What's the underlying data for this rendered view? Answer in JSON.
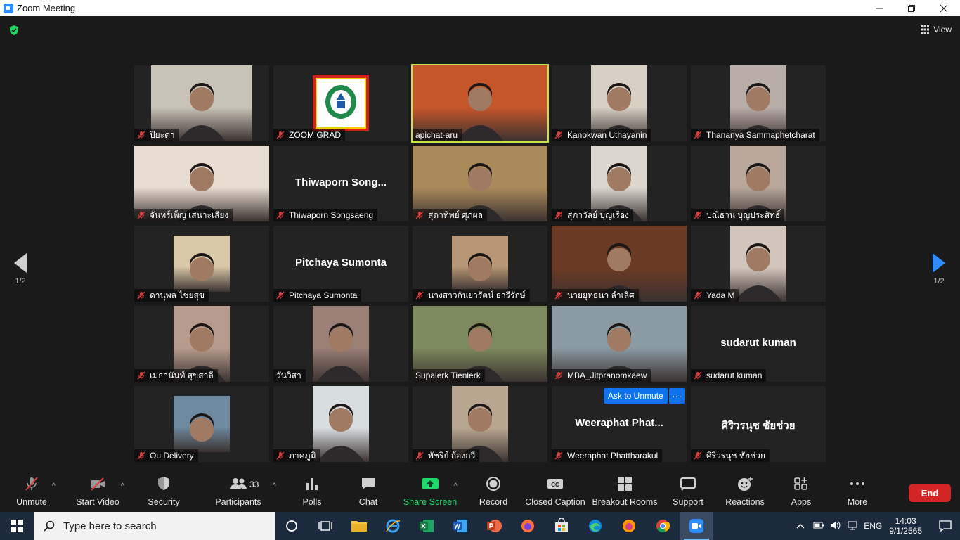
{
  "window": {
    "title": "Zoom Meeting"
  },
  "top": {
    "view_label": "View"
  },
  "pagination": {
    "left": "1/2",
    "right": "1/2"
  },
  "participants": [
    {
      "name": "ปิยะดา",
      "muted": true,
      "kind": "video",
      "bg": "#c9c2b6",
      "vx": 24,
      "vw": 144
    },
    {
      "name": "ZOOM GRAD",
      "muted": true,
      "kind": "logo",
      "bg": "#232323"
    },
    {
      "name": "apichat-aru",
      "muted": false,
      "kind": "video",
      "bg": "#c5562a",
      "vx": 0,
      "vw": 192,
      "active": true
    },
    {
      "name": "Kanokwan Uthayanin",
      "muted": true,
      "kind": "video",
      "bg": "#d8d0c4",
      "vx": 56,
      "vw": 80
    },
    {
      "name": "Thananya Sammaphetcharat",
      "muted": true,
      "kind": "video",
      "bg": "#b9ada8",
      "vx": 56,
      "vw": 80
    },
    {
      "name": "จันทร์เพ็ญ  เสนาะเสียง",
      "muted": true,
      "kind": "video",
      "bg": "#e6dccf",
      "vx": 0,
      "vw": 192
    },
    {
      "name": "Thiwaporn Songsaeng",
      "muted": true,
      "kind": "name",
      "display": "Thiwaporn  Song..."
    },
    {
      "name": "สุดาทิพย์  ศุภผล",
      "muted": true,
      "kind": "video",
      "bg": "#a98a5b",
      "vx": 0,
      "vw": 192
    },
    {
      "name": "สุภาวัลย์ บุญเรือง",
      "muted": true,
      "kind": "video",
      "bg": "#dcd6cf",
      "vx": 56,
      "vw": 80
    },
    {
      "name": "ปณิธาน บุญประสิทธิ์",
      "muted": true,
      "kind": "video",
      "bg": "#b8a79a",
      "vx": 56,
      "vw": 80
    },
    {
      "name": "ดานุพล ไชยสุข",
      "muted": true,
      "kind": "video",
      "bg": "#d8c8a8",
      "vx": 56,
      "vw": 80,
      "short": true
    },
    {
      "name": "Pitchaya Sumonta",
      "muted": true,
      "kind": "name",
      "display": "Pitchaya Sumonta"
    },
    {
      "name": "นางสาวกันยารัตน์ ธารีรักษ์",
      "muted": true,
      "kind": "video",
      "bg": "#b69674",
      "vx": 56,
      "vw": 80,
      "short": true
    },
    {
      "name": "นายยุทธนา  ลำเลิศ",
      "muted": true,
      "kind": "video",
      "bg": "#6b3a24",
      "vx": 0,
      "vw": 192
    },
    {
      "name": "Yada M",
      "muted": true,
      "kind": "video",
      "bg": "#d2c5bb",
      "vx": 56,
      "vw": 80
    },
    {
      "name": "เมธานันท์ สุขสาลี",
      "muted": true,
      "kind": "video",
      "bg": "#b79c8d",
      "vx": 56,
      "vw": 80
    },
    {
      "name": "วันวิสา",
      "muted": false,
      "kind": "video",
      "bg": "#9a8076",
      "vx": 56,
      "vw": 80
    },
    {
      "name": "Supalerk Tienlerk",
      "muted": false,
      "kind": "video",
      "bg": "#7d8a5f",
      "vx": 0,
      "vw": 192
    },
    {
      "name": "MBA_Jitpranomkaew",
      "muted": true,
      "kind": "video",
      "bg": "#8a9ba3",
      "vx": 0,
      "vw": 192
    },
    {
      "name": "sudarut kuman",
      "muted": true,
      "kind": "name",
      "display": "sudarut kuman"
    },
    {
      "name": "Ou Delivery",
      "muted": true,
      "kind": "video",
      "bg": "#6d8aa0",
      "vx": 56,
      "vw": 80,
      "short": true
    },
    {
      "name": "ภาคภูมิ",
      "muted": true,
      "kind": "video",
      "bg": "#d8dde0",
      "vx": 56,
      "vw": 80
    },
    {
      "name": "พัชริย์ ก้องกวี",
      "muted": true,
      "kind": "video",
      "bg": "#b8a690",
      "vx": 56,
      "vw": 80
    },
    {
      "name": "Weeraphat Phattharakul",
      "muted": true,
      "kind": "name",
      "display": "Weeraphat  Phat..."
    },
    {
      "name": "ศิริวรนุช ชัยช่วย",
      "muted": true,
      "kind": "name",
      "display": "ศิริวรนุช ชัยช่วย"
    }
  ],
  "tile_actions": {
    "ask_to_unmute": "Ask to Unmute",
    "more": "···"
  },
  "toolbar": {
    "unmute": "Unmute",
    "start_video": "Start Video",
    "security": "Security",
    "participants": "Participants",
    "participants_count": "33",
    "polls": "Polls",
    "chat": "Chat",
    "share_screen": "Share Screen",
    "record": "Record",
    "closed_caption": "Closed Caption",
    "breakout_rooms": "Breakout Rooms",
    "support": "Support",
    "reactions": "Reactions",
    "apps": "Apps",
    "more": "More",
    "end": "End"
  },
  "taskbar": {
    "search_placeholder": "Type here to search",
    "language": "ENG",
    "time": "14:03",
    "date": "9/1/2565"
  },
  "colors": {
    "accent": "#2d8cff",
    "share_green": "#1fd86c",
    "end_red": "#d42525",
    "active_speaker": "#c6e340"
  }
}
